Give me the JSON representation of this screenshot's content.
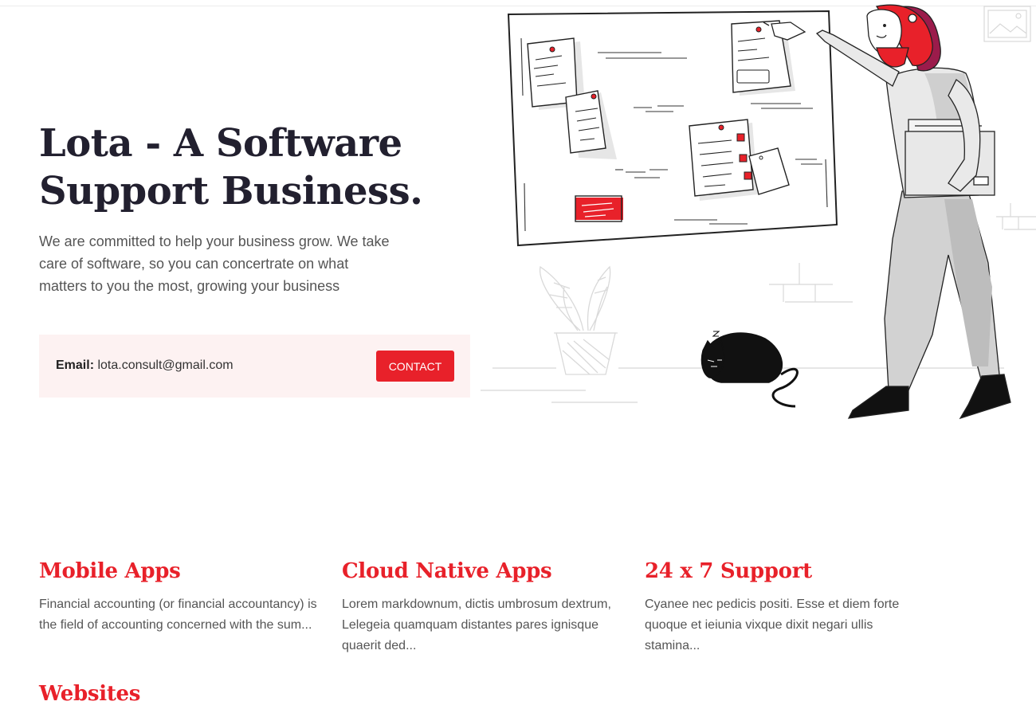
{
  "hero": {
    "title": "Lota - A Software Support Business.",
    "description": "We are committed to help your business grow. We take care of software, so you can concertrate on what matters to you the most, growing your business",
    "email_label": "Email:",
    "email_value": "lota.consult@gmail.com",
    "contact_label": "CONTACT"
  },
  "colors": {
    "accent": "#e8212a",
    "heading": "#22202f",
    "contact_bg": "#fdf2f2"
  },
  "features": [
    {
      "title": "Mobile Apps",
      "text": "Financial accounting (or financial accountancy) is the field of accounting concerned with the sum..."
    },
    {
      "title": "Cloud Native Apps",
      "text": "Lorem markdownum, dictis umbrosum dextrum, Lelegeia quamquam distantes pares ignisque quaerit ded..."
    },
    {
      "title": "24 x 7 Support",
      "text": "Cyanee nec pedicis positi. Esse et diem forte quoque et ieiunia vixque dixit negari ullis stamina..."
    },
    {
      "title": "Websites",
      "text": ""
    }
  ]
}
